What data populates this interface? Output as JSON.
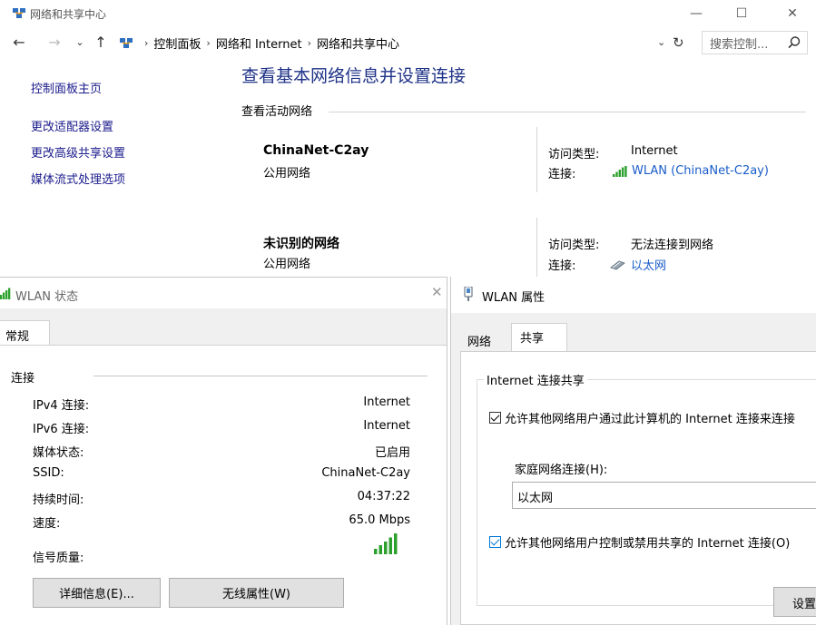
{
  "window": {
    "title": "网络和共享中心",
    "min_glyph": "—",
    "max_glyph": "☐",
    "close_glyph": "✕"
  },
  "nav": {
    "breadcrumbs": [
      "控制面板",
      "网络和 Internet",
      "网络和共享中心"
    ],
    "search_placeholder": "搜索控制..."
  },
  "sidebar": {
    "items": [
      "控制面板主页",
      "更改适配器设置",
      "更改高级共享设置",
      "媒体流式处理选项"
    ]
  },
  "main": {
    "heading": "查看基本网络信息并设置连接",
    "section_label": "查看活动网络",
    "networks": [
      {
        "name": "ChinaNet-C2ay",
        "type": "公用网络",
        "access_key": "访问类型:",
        "access_val": "Internet",
        "conn_key": "连接:",
        "conn_link": "WLAN (ChinaNet-C2ay)",
        "conn_icon": "wifi-signal-icon"
      },
      {
        "name": "未识别的网络",
        "type": "公用网络",
        "access_key": "访问类型:",
        "access_val": "无法连接到网络",
        "conn_key": "连接:",
        "conn_link": "以太网",
        "conn_icon": "ethernet-icon"
      }
    ]
  },
  "status_dialog": {
    "title": "WLAN 状态",
    "tab": "常规",
    "group": "连接",
    "rows": [
      {
        "key": "IPv4 连接:",
        "val": "Internet"
      },
      {
        "key": "IPv6 连接:",
        "val": "Internet"
      },
      {
        "key": "媒体状态:",
        "val": "已启用"
      },
      {
        "key": "SSID:",
        "val": "ChinaNet-C2ay"
      },
      {
        "key": "持续时间:",
        "val": "04:37:22"
      },
      {
        "key": "速度:",
        "val": "65.0 Mbps"
      }
    ],
    "signal_label": "信号质量:",
    "details_button": "详细信息(E)...",
    "wireless_button": "无线属性(W)"
  },
  "prop_dialog": {
    "title": "WLAN 属性",
    "tabs": [
      "网络",
      "共享"
    ],
    "legend": "Internet 连接共享",
    "allow_connect": "允许其他网络用户通过此计算机的 Internet 连接来连接",
    "home_label": "家庭网络连接(H):",
    "home_value": "以太网",
    "allow_control": "允许其他网络用户控制或禁用共享的 Internet 连接(O)",
    "settings_button": "设置"
  },
  "colors": {
    "link": "#1a5cc8",
    "heading": "#1e3287",
    "signal": "#2ca02c"
  }
}
